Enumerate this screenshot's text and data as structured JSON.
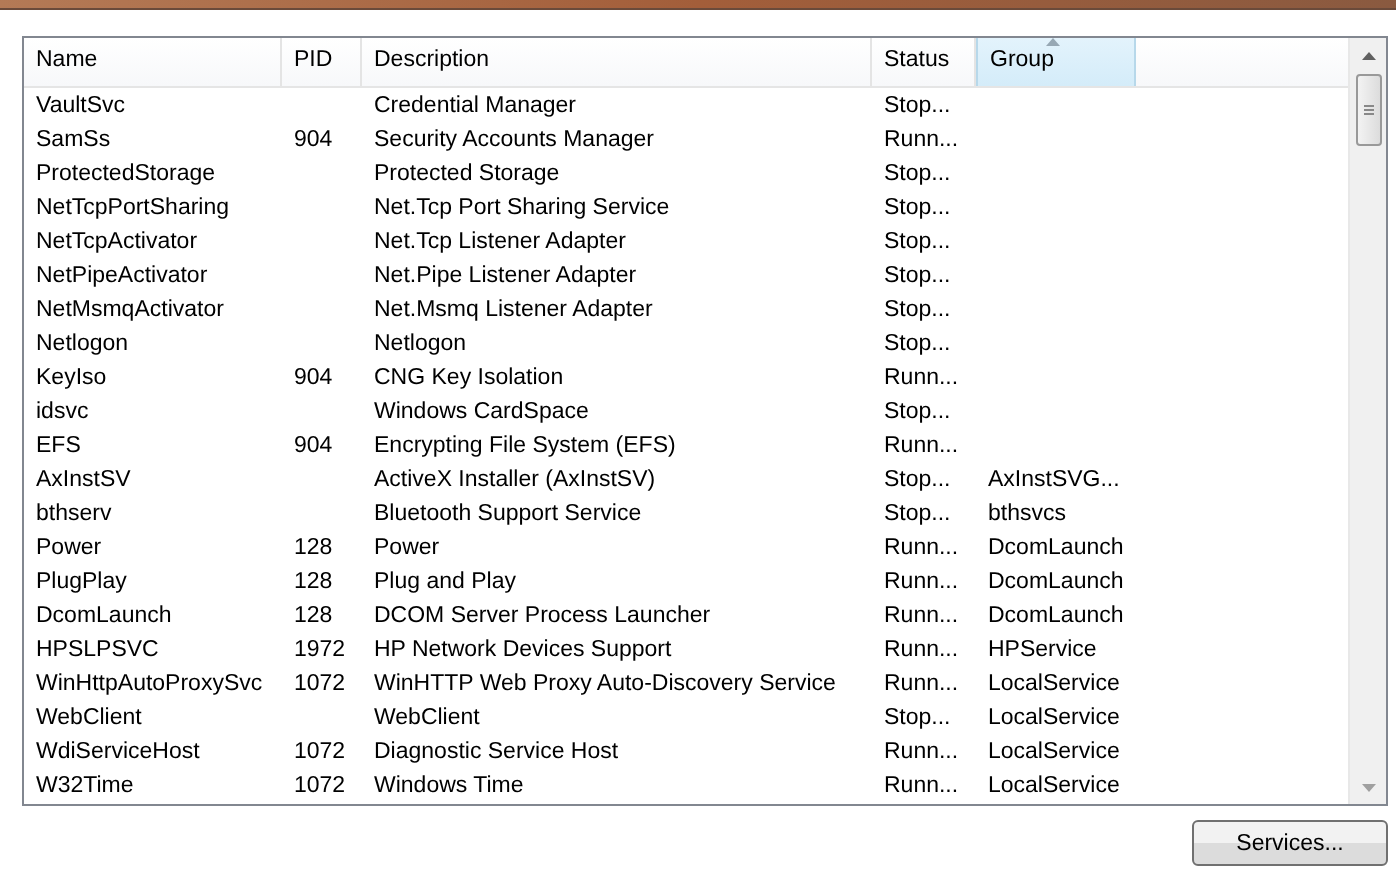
{
  "table": {
    "columns": [
      {
        "label": "Name",
        "sorted": false
      },
      {
        "label": "PID",
        "sorted": false
      },
      {
        "label": "Description",
        "sorted": false
      },
      {
        "label": "Status",
        "sorted": false
      },
      {
        "label": "Group",
        "sorted": true
      }
    ],
    "rows": [
      [
        "VaultSvc",
        "",
        "Credential Manager",
        "Stop...",
        ""
      ],
      [
        "SamSs",
        "904",
        "Security Accounts Manager",
        "Runn...",
        ""
      ],
      [
        "ProtectedStorage",
        "",
        "Protected Storage",
        "Stop...",
        ""
      ],
      [
        "NetTcpPortSharing",
        "",
        "Net.Tcp Port Sharing Service",
        "Stop...",
        ""
      ],
      [
        "NetTcpActivator",
        "",
        "Net.Tcp Listener Adapter",
        "Stop...",
        ""
      ],
      [
        "NetPipeActivator",
        "",
        "Net.Pipe Listener Adapter",
        "Stop...",
        ""
      ],
      [
        "NetMsmqActivator",
        "",
        "Net.Msmq Listener Adapter",
        "Stop...",
        ""
      ],
      [
        "Netlogon",
        "",
        "Netlogon",
        "Stop...",
        ""
      ],
      [
        "KeyIso",
        "904",
        "CNG Key Isolation",
        "Runn...",
        ""
      ],
      [
        "idsvc",
        "",
        "Windows CardSpace",
        "Stop...",
        ""
      ],
      [
        "EFS",
        "904",
        "Encrypting File System (EFS)",
        "Runn...",
        ""
      ],
      [
        "AxInstSV",
        "",
        "ActiveX Installer (AxInstSV)",
        "Stop...",
        "AxInstSVG..."
      ],
      [
        "bthserv",
        "",
        "Bluetooth Support Service",
        "Stop...",
        "bthsvcs"
      ],
      [
        "Power",
        "128",
        "Power",
        "Runn...",
        "DcomLaunch"
      ],
      [
        "PlugPlay",
        "128",
        "Plug and Play",
        "Runn...",
        "DcomLaunch"
      ],
      [
        "DcomLaunch",
        "128",
        "DCOM Server Process Launcher",
        "Runn...",
        "DcomLaunch"
      ],
      [
        "HPSLPSVC",
        "1972",
        "HP Network Devices Support",
        "Runn...",
        "HPService"
      ],
      [
        "WinHttpAutoProxySvc",
        "1072",
        "WinHTTP Web Proxy Auto-Discovery Service",
        "Runn...",
        "LocalService"
      ],
      [
        "WebClient",
        "",
        "WebClient",
        "Stop...",
        "LocalService"
      ],
      [
        "WdiServiceHost",
        "1072",
        "Diagnostic Service Host",
        "Runn...",
        "LocalService"
      ],
      [
        "W32Time",
        "1072",
        "Windows Time",
        "Runn...",
        "LocalService"
      ]
    ]
  },
  "buttons": [
    "Services..."
  ]
}
